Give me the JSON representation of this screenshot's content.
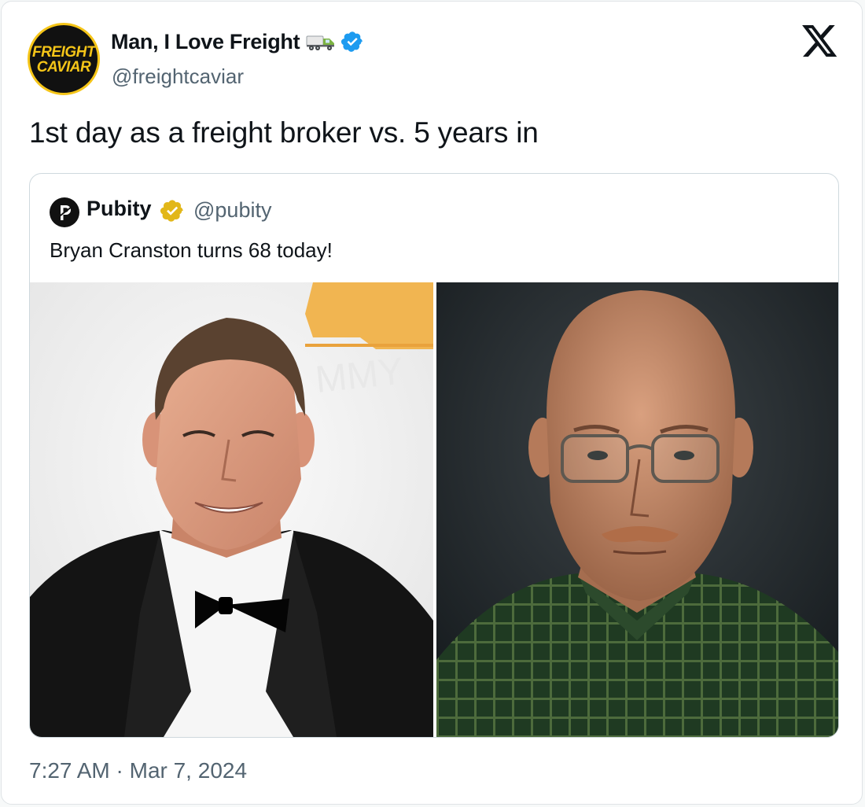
{
  "tweet": {
    "author": {
      "display_name": "Man, I Love Freight",
      "handle": "@freightcaviar",
      "avatar_line1": "FREIGHT",
      "avatar_line2": "CAVIAR",
      "avatar_icon": "freight-caviar-logo",
      "verified": true,
      "emoji": "delivery-truck"
    },
    "text": "1st day as a freight broker vs. 5 years in",
    "timestamp": "7:27 AM · Mar 7, 2024",
    "platform_icon": "x-logo"
  },
  "quote": {
    "author": {
      "display_name": "Pubity",
      "handle": "@pubity",
      "badge": "gold-verified",
      "avatar_icon": "pubity-p-logo"
    },
    "text": "Bryan Cranston turns 68 today!",
    "images": [
      {
        "subject": "smiling-man-in-tuxedo-at-emmys"
      },
      {
        "subject": "bald-man-glasses-mustache-plaid-shirt"
      }
    ]
  },
  "colors": {
    "text": "#0f1419",
    "secondary": "#536471",
    "verified_blue": "#1d9bf0",
    "gold_badge": "#e2b719",
    "border": "#cfd9de"
  }
}
